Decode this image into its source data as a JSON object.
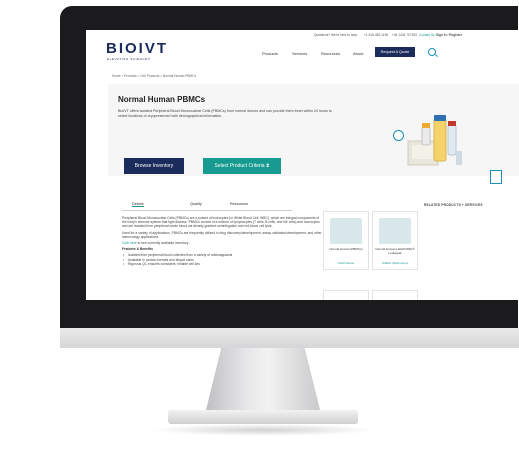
{
  "topbar": {
    "questions": "Questions? We're here to help:",
    "phone_us": "+1 516-483-1196",
    "phone_uk": "+44 1444 707333",
    "contact": "Contact Us",
    "signin": "Sign In / Register"
  },
  "header": {
    "logo": "BIOIVT",
    "tagline": "ELEVATING SCIENCE®",
    "nav": [
      "Products",
      "Services",
      "Resources",
      "About"
    ],
    "quote_button": "Request A Quote"
  },
  "breadcrumb": "Home  >  Products  >  Cell Products  >  Normal Human PBMCs",
  "hero": {
    "title": "Normal Human PBMCs",
    "intro": "BioIVT offers isolated Peripheral Blood Mononuclear Cells (PBMCs) from normal donors and can provide them fresh within 24 hours to select locations or cryopreserved with demographical information.",
    "browse_button": "Browse Inventory",
    "select_button": "Select Product Criteria"
  },
  "tabs": [
    "Details",
    "Quality",
    "Resources"
  ],
  "details": {
    "para1": "Peripheral Blood Mononuclear Cells (PBMCs) are a subset of leukocytes (or White Blood Cell, WBC), which are integral components of the body's immune system that fight disease. PBMCs consist of a mixture of lymphocytes (T cells, B cells, and NK cells) and monocytes and are isolated from peripheral whole blood via density gradient centrifugation and red blood cell lysis.",
    "para2": "Used for a variety of applications, PBMCs are frequently utilized in drug discovery/development, assay validation/development, and other immunology applications.",
    "click_link": "Click here",
    "click_rest": " to see currently available inventory.",
    "features_heading": "Features & Benefits",
    "features": [
      "Isolated from peripheral blood collected from a variety of anticoagulants",
      "Available in custom formats and aliquot sizes",
      "Rigorous QC ensures consistent, reliable cell lots"
    ]
  },
  "related": {
    "heading": "RELATED PRODUCTS + SERVICES",
    "cards": [
      {
        "name": "Normal Human (PBMCs)",
        "sub": "Cell Products"
      },
      {
        "name": "Normal Human LEUKOPAK® Leukopak",
        "sub": "Unfilled (Stock Items)"
      }
    ]
  },
  "colors": {
    "navy": "#1a2b5c",
    "teal": "#179a8f",
    "accent_blue": "#1a8fb8"
  }
}
